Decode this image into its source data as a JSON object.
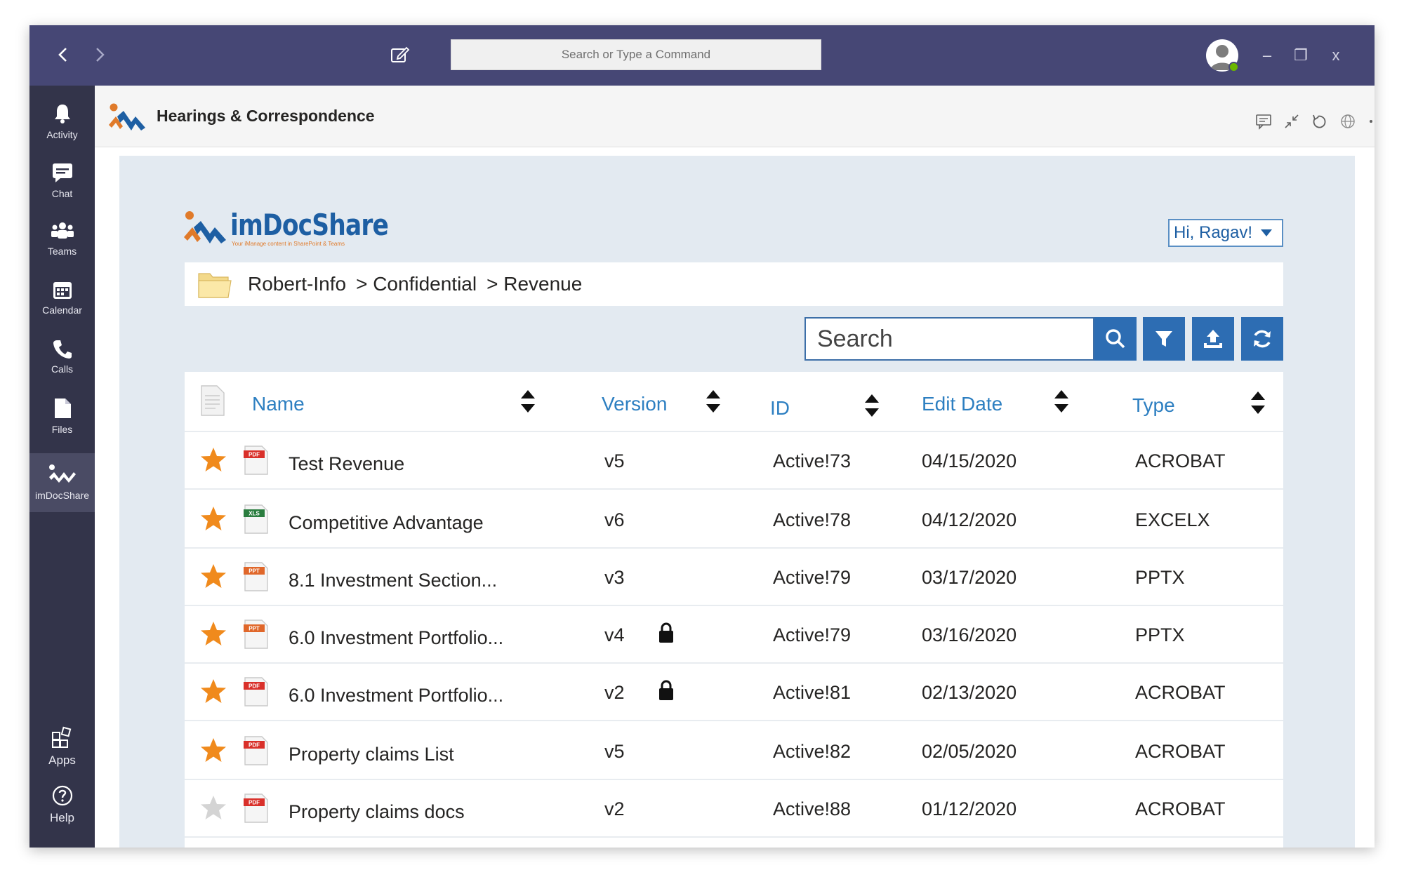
{
  "titlebar": {
    "command_placeholder": "Search or Type a Command",
    "back_icon": "chevron-left-icon",
    "forward_icon": "chevron-right-icon",
    "compose_icon": "compose-icon",
    "minimize_label": "–",
    "maximize_label": "❐",
    "close_label": "x"
  },
  "rail": {
    "items": [
      {
        "label": "Activity",
        "icon": "bell-icon"
      },
      {
        "label": "Chat",
        "icon": "chat-icon"
      },
      {
        "label": "Teams",
        "icon": "teams-icon"
      },
      {
        "label": "Calendar",
        "icon": "calendar-icon"
      },
      {
        "label": "Calls",
        "icon": "phone-icon"
      },
      {
        "label": "Files",
        "icon": "file-icon"
      },
      {
        "label": "imDocShare",
        "icon": "imdocshare-icon",
        "active": true
      }
    ],
    "bottom": [
      {
        "label": "Apps",
        "icon": "apps-icon"
      },
      {
        "label": "Help",
        "icon": "help-icon"
      }
    ]
  },
  "app_header": {
    "title": "Hearings & Correspondence"
  },
  "brand": {
    "name": "imDocShare",
    "tagline": "Your iManage content in SharePoint & Teams",
    "colors": {
      "primary": "#1e5fa3",
      "accent": "#e07a2a",
      "button": "#2d6db3"
    }
  },
  "user_menu": {
    "greeting": "Hi, Ragav!"
  },
  "breadcrumb": {
    "items": [
      "Robert-Info",
      "> Confidential",
      "> Revenue"
    ]
  },
  "search": {
    "placeholder": "Search"
  },
  "table": {
    "columns": [
      "Name",
      "Version",
      "ID",
      "Edit Date",
      "Type"
    ],
    "rows": [
      {
        "favorite": true,
        "file_type": "PDF",
        "name": "Test Revenue",
        "version": "v5",
        "locked": false,
        "id": "Active!73",
        "edit_date": "04/15/2020",
        "type": "ACROBAT"
      },
      {
        "favorite": true,
        "file_type": "XLS",
        "name": "Competitive Advantage",
        "version": "v6",
        "locked": false,
        "id": "Active!78",
        "edit_date": "04/12/2020",
        "type": "EXCELX"
      },
      {
        "favorite": true,
        "file_type": "PPT",
        "name": "8.1 Investment Section...",
        "version": "v3",
        "locked": false,
        "id": "Active!79",
        "edit_date": "03/17/2020",
        "type": "PPTX"
      },
      {
        "favorite": true,
        "file_type": "PPT",
        "name": "6.0 Investment Portfolio...",
        "version": "v4",
        "locked": true,
        "id": "Active!79",
        "edit_date": "03/16/2020",
        "type": "PPTX"
      },
      {
        "favorite": true,
        "file_type": "PDF",
        "name": "6.0 Investment Portfolio...",
        "version": "v2",
        "locked": true,
        "id": "Active!81",
        "edit_date": "02/13/2020",
        "type": "ACROBAT"
      },
      {
        "favorite": true,
        "file_type": "PDF",
        "name": "Property claims List",
        "version": "v5",
        "locked": false,
        "id": "Active!82",
        "edit_date": "02/05/2020",
        "type": "ACROBAT"
      },
      {
        "favorite": false,
        "file_type": "PDF",
        "name": "Property claims docs",
        "version": "v2",
        "locked": false,
        "id": "Active!88",
        "edit_date": "01/12/2020",
        "type": "ACROBAT"
      }
    ]
  }
}
